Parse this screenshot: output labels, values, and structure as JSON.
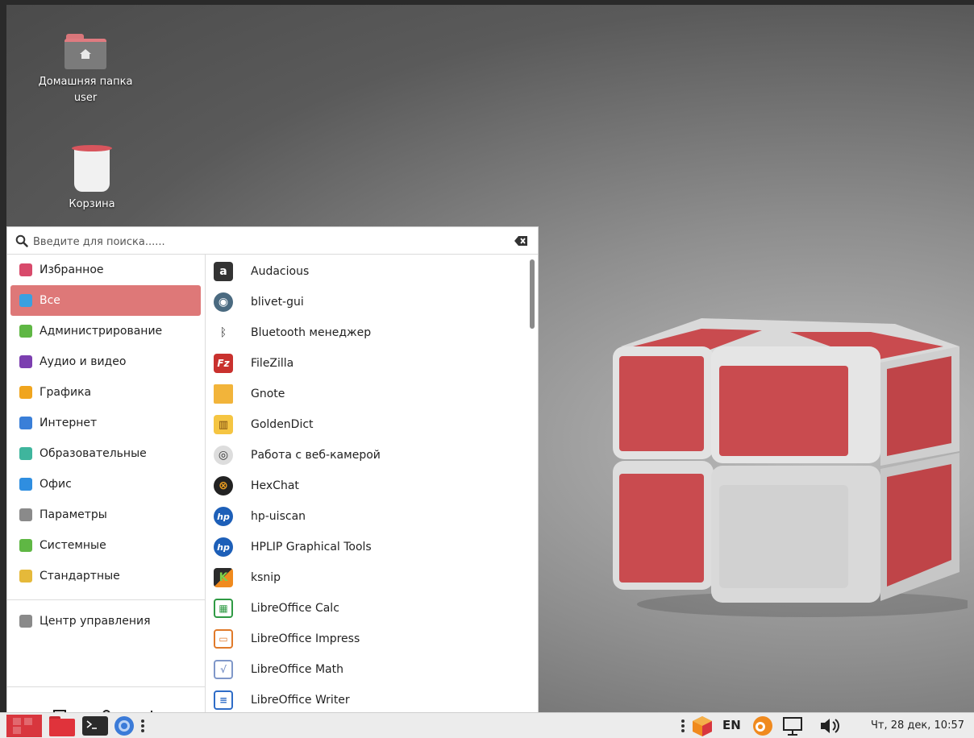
{
  "desktop": {
    "icons": [
      {
        "label_line1": "Домашняя папка",
        "label_line2": "user"
      },
      {
        "label_line1": "Корзина"
      }
    ]
  },
  "menu": {
    "search": {
      "placeholder": "Введите для поиска......"
    },
    "categories": [
      {
        "label": "Избранное",
        "color": "#d84a6b"
      },
      {
        "label": "Все",
        "color": "#3aa0e0",
        "active": true
      },
      {
        "label": "Администрирование",
        "color": "#5fb744"
      },
      {
        "label": "Аудио и видео",
        "color": "#7c3fb0"
      },
      {
        "label": "Графика",
        "color": "#f0a51e"
      },
      {
        "label": "Интернет",
        "color": "#3a7fd8"
      },
      {
        "label": "Образовательные",
        "color": "#3fb59d"
      },
      {
        "label": "Офис",
        "color": "#2f8ee0"
      },
      {
        "label": "Параметры",
        "color": "#8a8a8a"
      },
      {
        "label": "Системные",
        "color": "#5fb744"
      },
      {
        "label": "Стандартные",
        "color": "#e5b93a"
      }
    ],
    "control_center": {
      "label": "Центр управления",
      "color": "#8a8a8a"
    },
    "session": {
      "logout_icon": "logout-icon",
      "lock_icon": "lock-icon",
      "power_icon": "power-icon"
    },
    "apps": [
      {
        "label": "Audacious",
        "icon": "audacious-icon",
        "color": "#333333",
        "glyph": "a"
      },
      {
        "label": "blivet-gui",
        "icon": "blivet-icon",
        "color": "#4a6a80",
        "glyph": "◉"
      },
      {
        "label": "Bluetooth менеджер",
        "icon": "bluetooth-icon",
        "color": "#ffffff",
        "glyph": "✱"
      },
      {
        "label": "FileZilla",
        "icon": "filezilla-icon",
        "color": "#c9312e",
        "glyph": "Fz"
      },
      {
        "label": "Gnote",
        "icon": "gnote-icon",
        "color": "#f2b43a",
        "glyph": ""
      },
      {
        "label": "GoldenDict",
        "icon": "goldendict-icon",
        "color": "#f5c542",
        "glyph": "📖"
      },
      {
        "label": "Работа с веб-камерой",
        "icon": "webcam-icon",
        "color": "#dddddd",
        "glyph": "◎"
      },
      {
        "label": "HexChat",
        "icon": "hexchat-icon",
        "color": "#222222",
        "glyph": "⊗"
      },
      {
        "label": "hp-uiscan",
        "icon": "hp-icon",
        "color": "#1d5fb8",
        "glyph": "hp"
      },
      {
        "label": "HPLIP Graphical Tools",
        "icon": "hplip-icon",
        "color": "#1d5fb8",
        "glyph": "hp"
      },
      {
        "label": "ksnip",
        "icon": "ksnip-icon",
        "color": "#2b2b2b",
        "glyph": "K"
      },
      {
        "label": "LibreOffice Calc",
        "icon": "calc-icon",
        "color": "#2f9a44",
        "glyph": "▦"
      },
      {
        "label": "LibreOffice Impress",
        "icon": "impress-icon",
        "color": "#e07a2a",
        "glyph": "▭"
      },
      {
        "label": "LibreOffice Math",
        "icon": "math-icon",
        "color": "#7f97c9",
        "glyph": "√"
      },
      {
        "label": "LibreOffice Writer",
        "icon": "writer-icon",
        "color": "#2e6cc7",
        "glyph": "≡"
      }
    ]
  },
  "taskbar": {
    "lang": "EN",
    "clock": "Чт, 28 дек, 10:57"
  }
}
